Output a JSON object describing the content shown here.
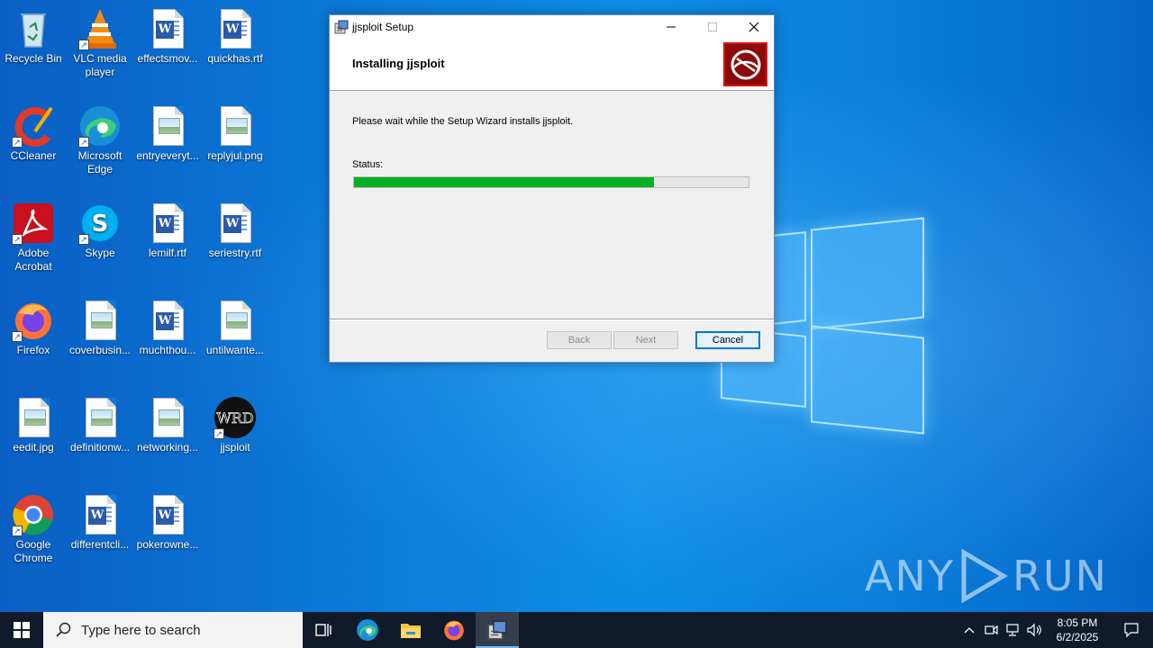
{
  "desktop": {
    "icons": [
      {
        "label": "Recycle Bin",
        "icon": "recycle-bin-icon"
      },
      {
        "label": "VLC media player",
        "icon": "vlc-icon"
      },
      {
        "label": "effectsmov...",
        "icon": "word-doc-icon"
      },
      {
        "label": "quickhas.rtf",
        "icon": "word-doc-icon"
      },
      {
        "label": "CCleaner",
        "icon": "ccleaner-icon"
      },
      {
        "label": "Microsoft Edge",
        "icon": "edge-icon"
      },
      {
        "label": "entryeveryt...",
        "icon": "image-file-icon"
      },
      {
        "label": "replyjul.png",
        "icon": "image-file-icon"
      },
      {
        "label": "Adobe Acrobat",
        "icon": "acrobat-icon"
      },
      {
        "label": "Skype",
        "icon": "skype-icon"
      },
      {
        "label": "lemilf.rtf",
        "icon": "word-doc-icon"
      },
      {
        "label": "seriestry.rtf",
        "icon": "word-doc-icon"
      },
      {
        "label": "Firefox",
        "icon": "firefox-icon"
      },
      {
        "label": "coverbusin...",
        "icon": "image-file-icon"
      },
      {
        "label": "muchthou...",
        "icon": "word-doc-icon"
      },
      {
        "label": "untilwante...",
        "icon": "image-file-icon"
      },
      {
        "label": "eedit.jpg",
        "icon": "image-file-icon"
      },
      {
        "label": "definitionw...",
        "icon": "image-file-icon"
      },
      {
        "label": "networking...",
        "icon": "image-file-icon"
      },
      {
        "label": "jjsploit",
        "icon": "jjsploit-icon"
      },
      {
        "label": "Google Chrome",
        "icon": "chrome-icon"
      },
      {
        "label": "differentcli...",
        "icon": "word-doc-icon"
      },
      {
        "label": "pokerowne...",
        "icon": "word-doc-icon"
      }
    ],
    "watermark": {
      "left": "ANY",
      "right": "RUN"
    }
  },
  "setup_window": {
    "title": "jjsploit Setup",
    "header_title": "Installing jjsploit",
    "message": "Please wait while the Setup Wizard installs jjsploit.",
    "status_label": "Status:",
    "progress": 0.76,
    "buttons": {
      "back": "Back",
      "next": "Next",
      "cancel": "Cancel"
    },
    "colors": {
      "progress_fill": "#06b025",
      "banner": "#8c0a0a"
    }
  },
  "taskbar": {
    "search_placeholder": "Type here to search",
    "apps": [
      "task-view-icon",
      "edge-icon",
      "file-explorer-icon",
      "firefox-icon",
      "installer-icon"
    ],
    "clock_time": "8:05 PM",
    "clock_date": "6/2/2025"
  }
}
